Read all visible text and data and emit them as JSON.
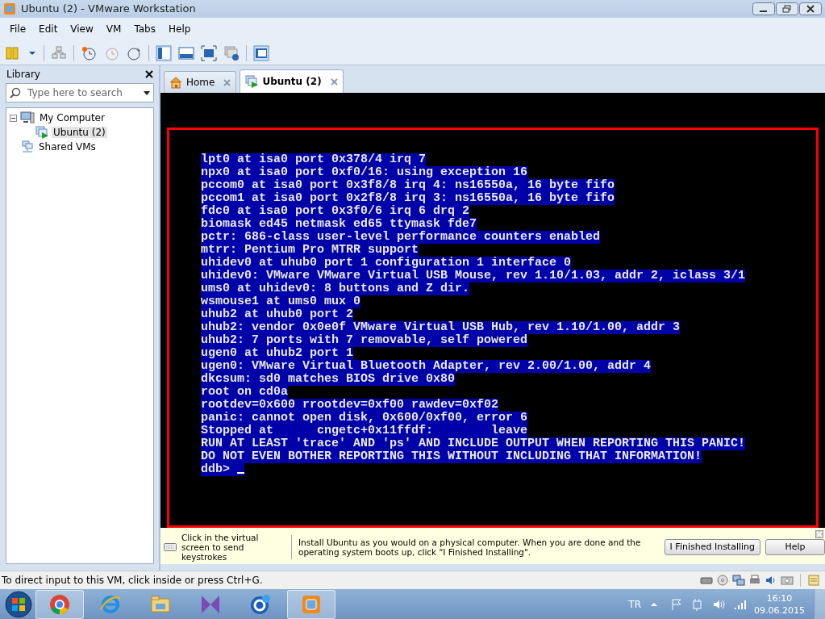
{
  "window": {
    "title": "Ubuntu (2) - VMware Workstation"
  },
  "menu": [
    "File",
    "Edit",
    "View",
    "VM",
    "Tabs",
    "Help"
  ],
  "library": {
    "title": "Library",
    "search": {
      "placeholder": "Type here to search"
    },
    "tree": [
      {
        "label": "My Computer",
        "expanded": true,
        "selected": false,
        "children": [
          {
            "label": "Ubuntu (2)",
            "selected": true
          }
        ]
      },
      {
        "label": "Shared VMs",
        "selected": false
      }
    ]
  },
  "tabs": [
    {
      "label": "Home",
      "selected": false
    },
    {
      "label": "Ubuntu (2)",
      "selected": true
    }
  ],
  "console": {
    "lines": [
      "lpt0 at isa0 port 0x378/4 irq 7",
      "npx0 at isa0 port 0xf0/16: using exception 16",
      "pccom0 at isa0 port 0x3f8/8 irq 4: ns16550a, 16 byte fifo",
      "pccom1 at isa0 port 0x2f8/8 irq 3: ns16550a, 16 byte fifo",
      "fdc0 at isa0 port 0x3f0/6 irq 6 drq 2",
      "biomask ed45 netmask ed65 ttymask fde7",
      "pctr: 686-class user-level performance counters enabled",
      "mtrr: Pentium Pro MTRR support",
      "uhidev0 at uhub0 port 1 configuration 1 interface 0",
      "uhidev0: VMware VMware Virtual USB Mouse, rev 1.10/1.03, addr 2, iclass 3/1",
      "ums0 at uhidev0: 8 buttons and Z dir.",
      "wsmouse1 at ums0 mux 0",
      "uhub2 at uhub0 port 2",
      "uhub2: vendor 0x0e0f VMware Virtual USB Hub, rev 1.10/1.00, addr 3",
      "uhub2: 7 ports with 7 removable, self powered",
      "ugen0 at uhub2 port 1",
      "ugen0: VMware Virtual Bluetooth Adapter, rev 2.00/1.00, addr 4",
      "dkcsum: sd0 matches BIOS drive 0x80",
      "root on cd0a",
      "rootdev=0x600 rrootdev=0xf00 rawdev=0xf02",
      "panic: cannot open disk, 0x600/0xf00, error 6",
      "Stopped at      cngetc+0x11ffdf:        leave",
      "RUN AT LEAST 'trace' AND 'ps' AND INCLUDE OUTPUT WHEN REPORTING THIS PANIC!",
      "DO NOT EVEN BOTHER REPORTING THIS WITHOUT INCLUDING THAT INFORMATION!"
    ],
    "prompt": "ddb> "
  },
  "hint_bar": {
    "keystrokes": "Click in the virtual screen to send keystrokes",
    "message": "Install Ubuntu as you would on a physical computer. When you are done and the operating system boots up, click \"I Finished Installing\".",
    "buttons": [
      "I Finished Installing",
      "Help"
    ]
  },
  "status_bar": "To direct input to this VM, click inside or press Ctrl+G.",
  "taskbar": {
    "language": "TR",
    "time": "16:10",
    "date": "09.06.2015"
  }
}
